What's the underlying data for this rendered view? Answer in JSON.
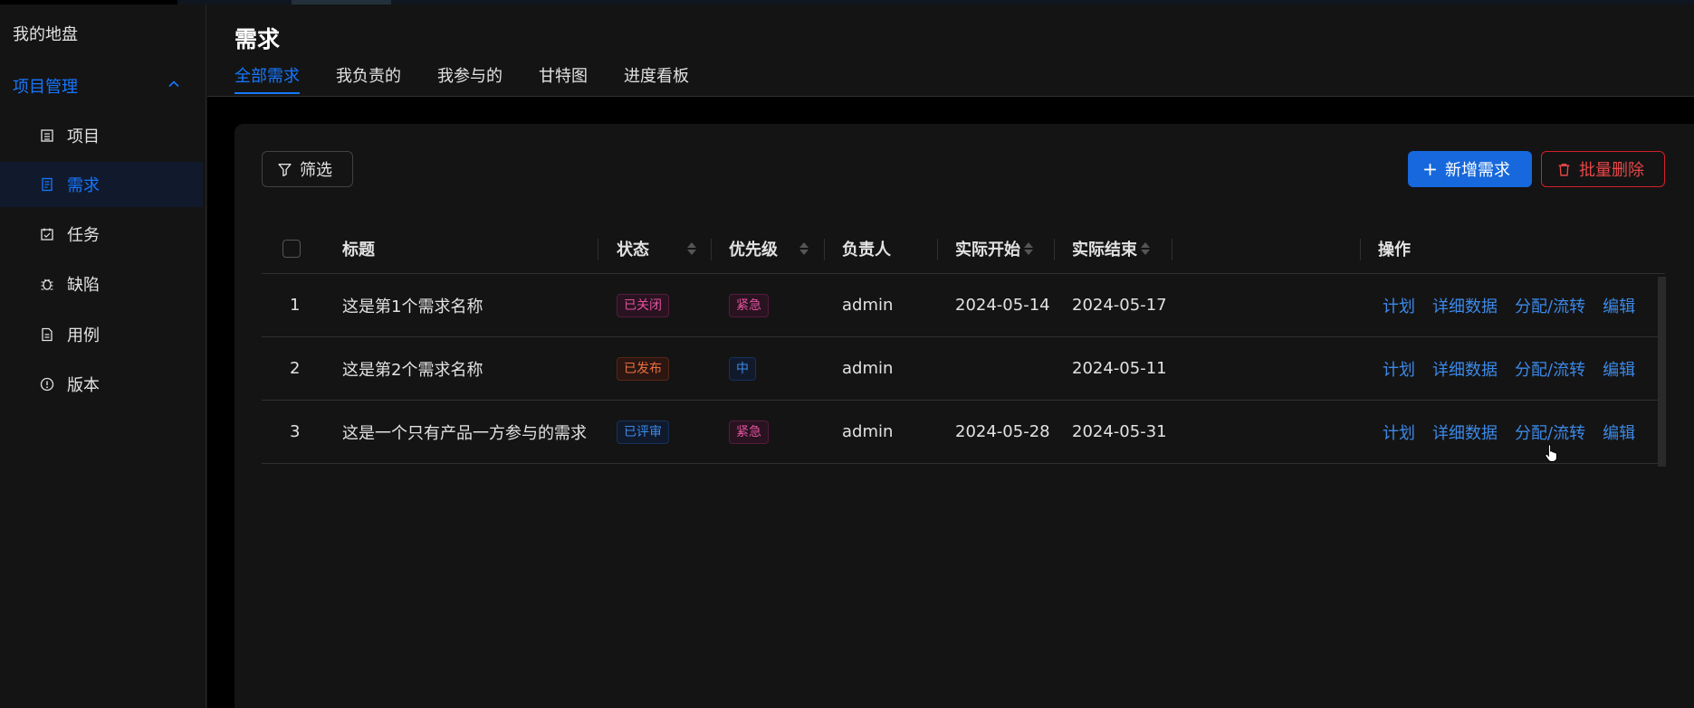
{
  "sidebar": {
    "top_label": "我的地盘",
    "group_label": "项目管理",
    "items": [
      {
        "label": "项目",
        "icon": "project-icon"
      },
      {
        "label": "需求",
        "icon": "requirement-icon"
      },
      {
        "label": "任务",
        "icon": "task-icon"
      },
      {
        "label": "缺陷",
        "icon": "bug-icon"
      },
      {
        "label": "用例",
        "icon": "testcase-icon"
      },
      {
        "label": "版本",
        "icon": "version-icon"
      }
    ]
  },
  "header": {
    "title": "需求",
    "tabs": [
      "全部需求",
      "我负责的",
      "我参与的",
      "甘特图",
      "进度看板"
    ]
  },
  "toolbar": {
    "filter_label": "筛选",
    "add_label": "新增需求",
    "batch_delete_label": "批量删除"
  },
  "table": {
    "columns": [
      "标题",
      "状态",
      "优先级",
      "负责人",
      "实际开始",
      "实际结束",
      "操作"
    ],
    "rows": [
      {
        "index": "1",
        "title": "这是第1个需求名称",
        "status": "已关闭",
        "status_color": "magenta",
        "priority": "紧急",
        "priority_color": "magenta",
        "owner": "admin",
        "start": "2024-05-14",
        "end": "2024-05-17"
      },
      {
        "index": "2",
        "title": "这是第2个需求名称",
        "status": "已发布",
        "status_color": "volcano",
        "priority": "中",
        "priority_color": "blue",
        "owner": "admin",
        "start": "",
        "end": "2024-05-11"
      },
      {
        "index": "3",
        "title": "这是一个只有产品一方参与的需求",
        "status": "已评审",
        "status_color": "blue",
        "priority": "紧急",
        "priority_color": "magenta",
        "owner": "admin",
        "start": "2024-05-28",
        "end": "2024-05-31"
      }
    ],
    "actions": [
      "计划",
      "详细数据",
      "分配/流转",
      "编辑"
    ]
  },
  "colors": {
    "accent": "#1677ff",
    "danger": "#e84749",
    "background": "#141414"
  }
}
